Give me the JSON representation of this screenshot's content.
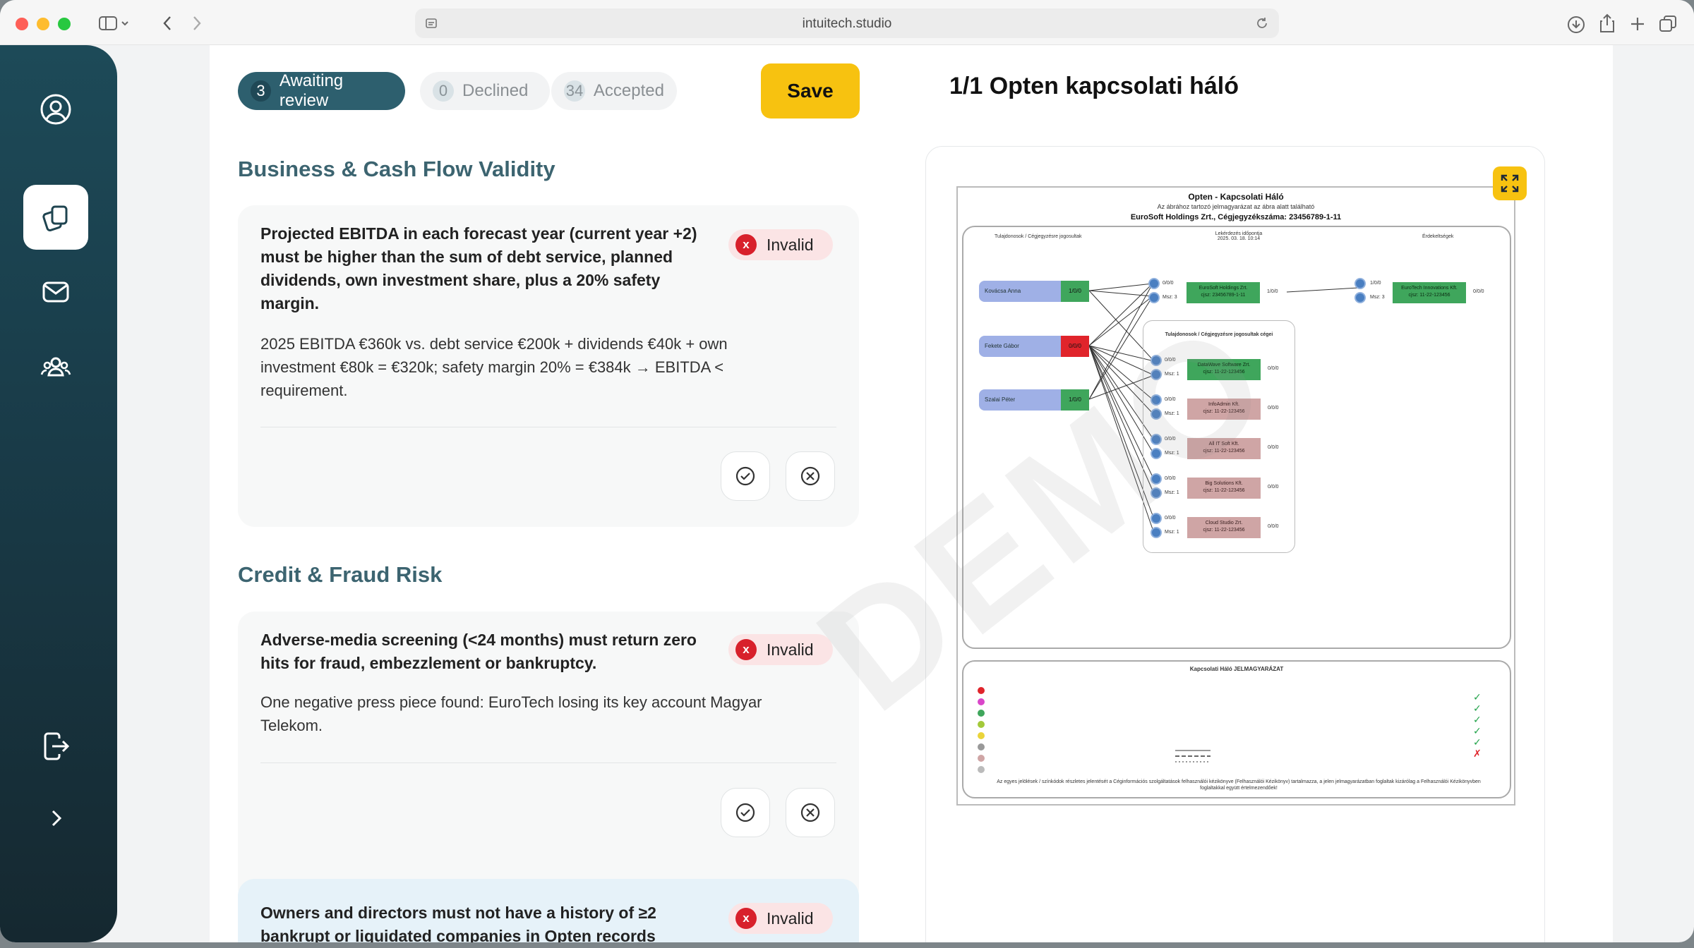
{
  "browser": {
    "url": "intuitech.studio"
  },
  "tabs": [
    {
      "count": "3",
      "label": "Awaiting review"
    },
    {
      "count": "0",
      "label": "Declined"
    },
    {
      "count": "34",
      "label": "Accepted"
    }
  ],
  "save_label": "Save",
  "sections": [
    {
      "title": "Business & Cash Flow Validity",
      "rules": [
        {
          "title": "Projected EBITDA in each forecast year (current year +2) must be higher than the sum of debt service, planned dividends, own investment share, plus a 20% safety margin.",
          "status": "Invalid",
          "detail": "2025 EBITDA €360k vs. debt service €200k + dividends €40k + own investment €80k = €320k; safety margin 20% = €384k → EBITDA < requirement."
        }
      ]
    },
    {
      "title": "Credit & Fraud Risk",
      "rules": [
        {
          "title": "Adverse-media screening (<24 months) must return zero hits for fraud, embezzlement or bankruptcy.",
          "status": "Invalid",
          "detail": "One negative press piece found: EuroTech losing its key account Magyar Telekom."
        },
        {
          "title": "Owners and directors must not have a history of ≥2 bankrupt or liquidated companies in Opten records",
          "status": "Invalid"
        }
      ]
    }
  ],
  "viewer": {
    "title": "1/1 Opten kapcsolati háló",
    "doc": {
      "heading": "Opten - Kapcsolati Háló",
      "subheading": "Az ábrához tartozó jelmagyarázat az ábra alatt található",
      "company_line": "EuroSoft Holdings Zrt., Cégjegyzékszáma: 23456789-1-11",
      "col_left": "Tulajdonosok / Cégjegyzésre jogosultak",
      "col_mid": "Lekérdezés időpontja\n2025. 03. 18. 10:14",
      "col_right": "Érdekeltségek",
      "persons": [
        {
          "name": "Kovácsa Anna",
          "stat": "1/0/0",
          "color": "#3fa65c"
        },
        {
          "name": "Fekete Gábor",
          "stat": "0/0/0",
          "color": "#e0242b"
        },
        {
          "name": "Szalai Péter",
          "stat": "1/0/0",
          "color": "#3fa65c"
        }
      ],
      "center_company": "EuroSoft Holdings Zrt.\ncjsz: 23456789-1-11",
      "center_stat": "1/0/0",
      "right_company": "EuroTech Innovations Kft.\ncjsz: 11-22-123456",
      "right_stat": "0/0/0",
      "sub_title": "Tulajdonosok / Cégjegyzésre jogosultak cégei",
      "sub_companies": [
        {
          "name": "DataWave Software Zrt.\ncjsz: 11-22-123456",
          "color": "green"
        },
        {
          "name": "InfoAdmin Kft.\ncjsz: 11-22-123456",
          "color": "pink"
        },
        {
          "name": "All IT Soft Kft.\ncjsz: 11-22-123456",
          "color": "pink"
        },
        {
          "name": "Big Solutions Kft.\ncjsz: 11-22-123456",
          "color": "pink"
        },
        {
          "name": "Cloud Studio Zrt.\ncjsz: 11-22-123456",
          "color": "pink"
        }
      ],
      "legend_title": "Kapcsolati Háló JELMAGYARÁZAT",
      "legend_footer": "Az egyes jelölések / színkódok részletes jelentését a Céginformációs szolgáltatások felhasználói kézikönyve (Felhasználói Kézikönyv) tartalmazza, a jelen jelmagyarázatban foglaltak kizárólag a Felhasználói Kézikönyvben foglaltakkal együtt értelmezendőek!",
      "watermark": "DEMO"
    }
  }
}
